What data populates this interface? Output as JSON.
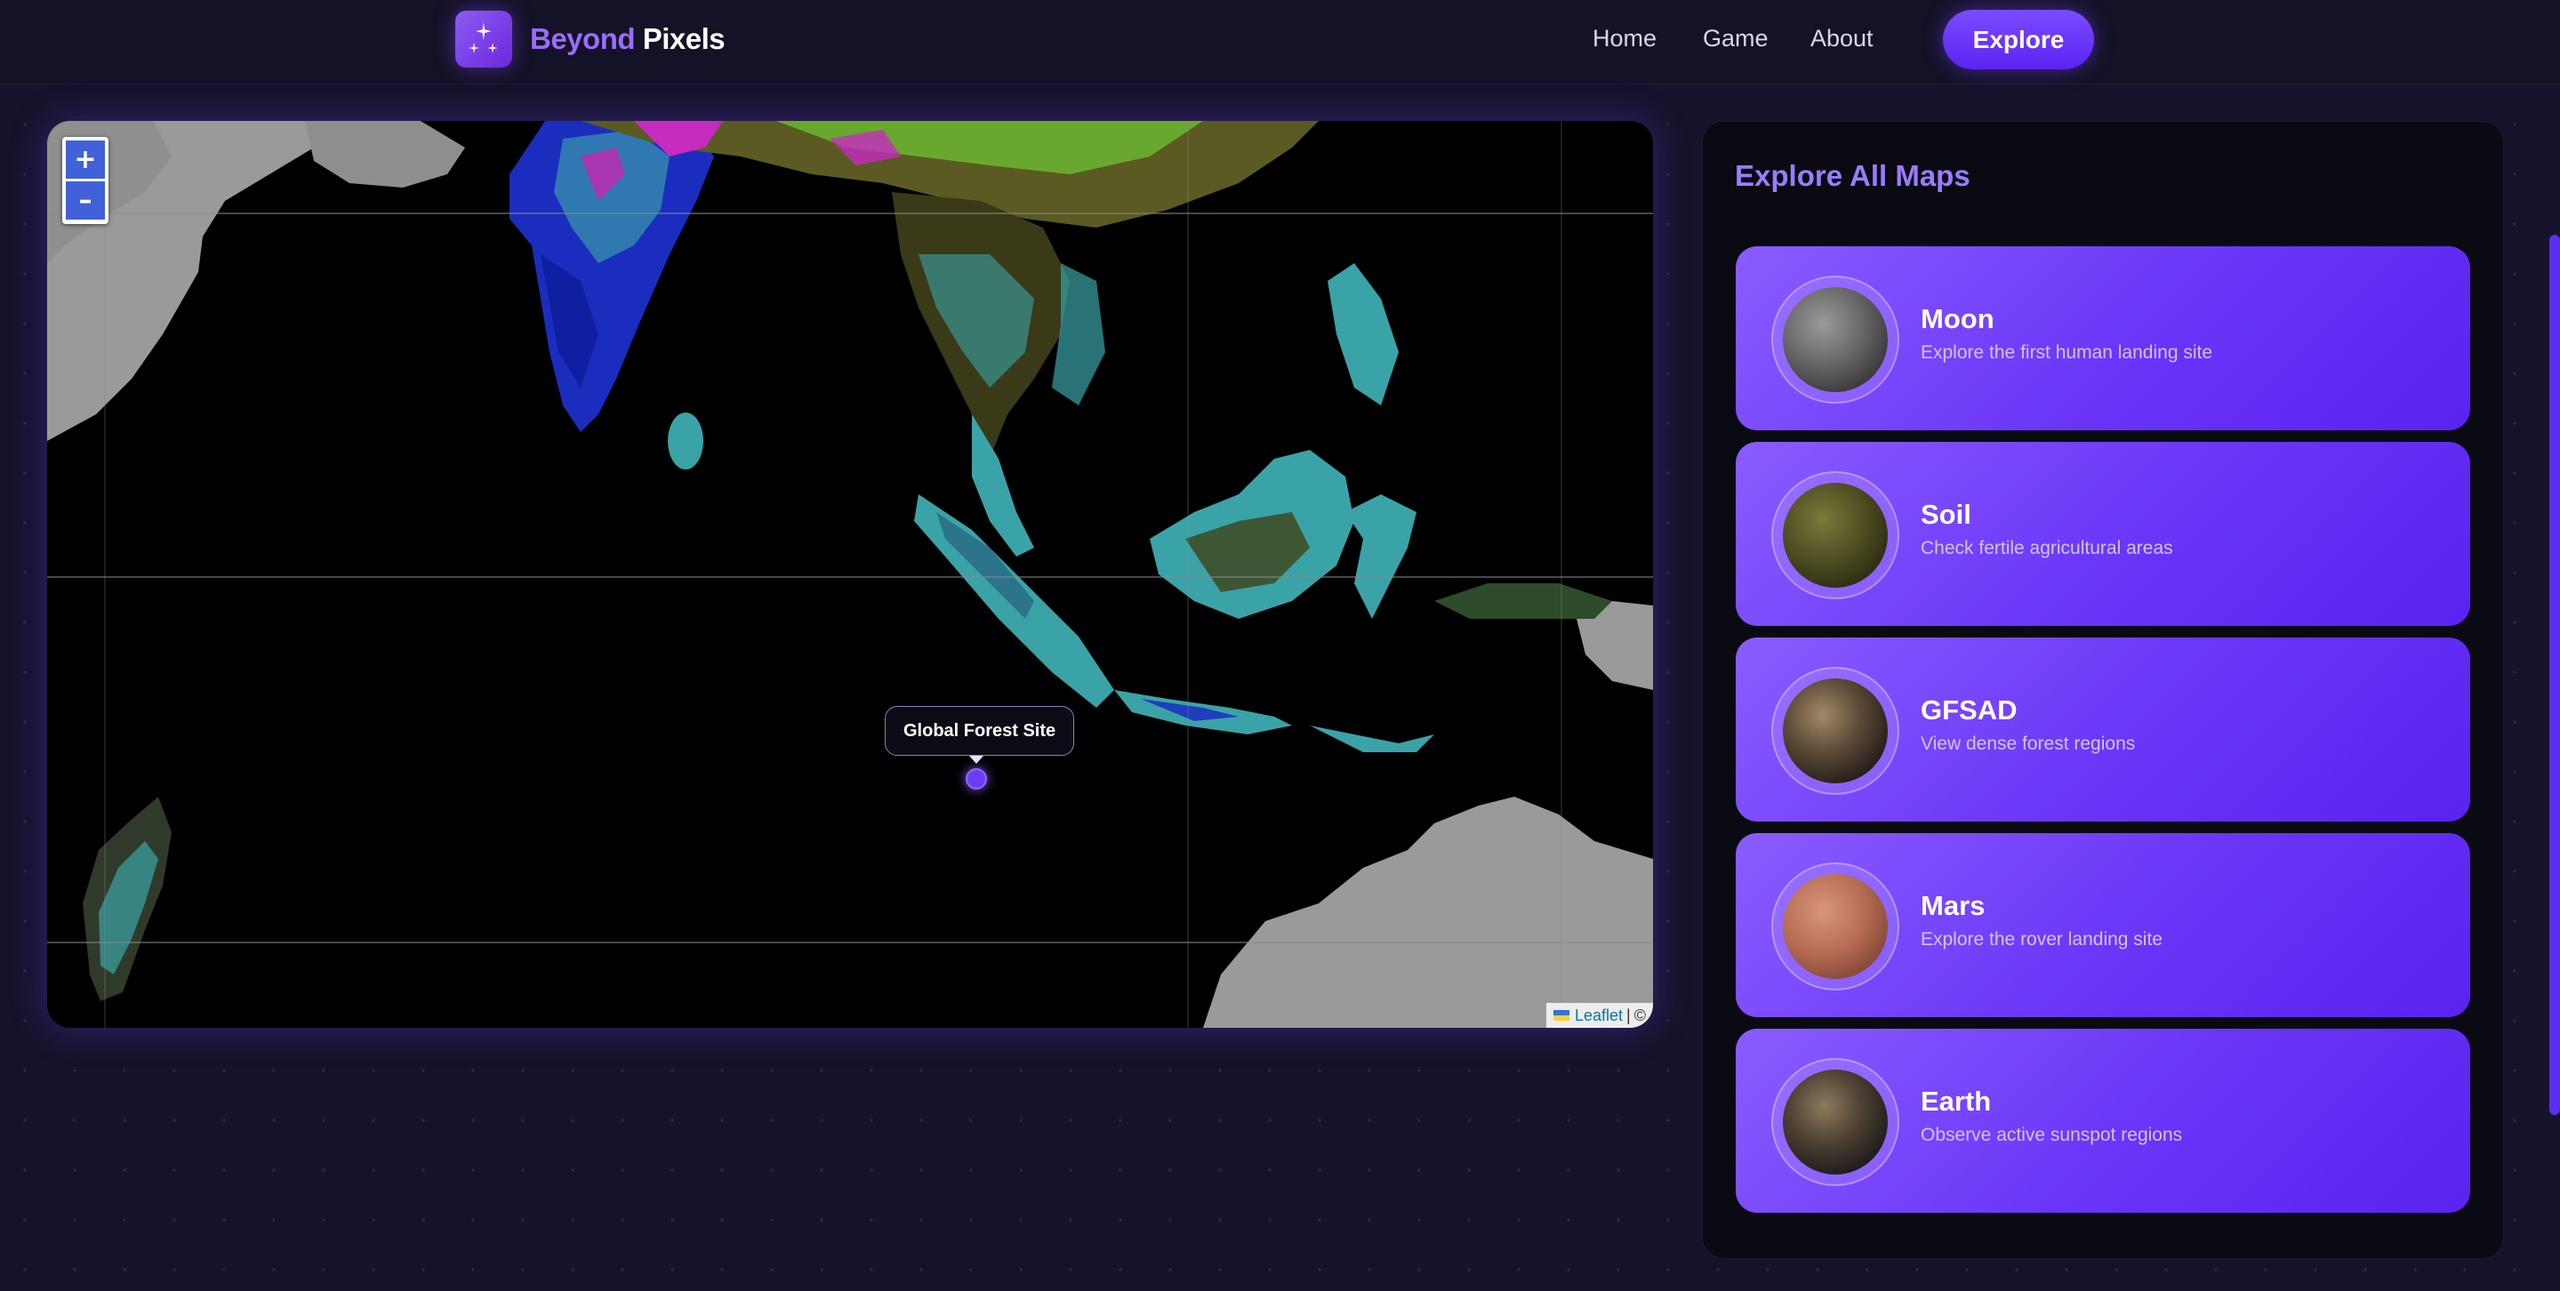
{
  "header": {
    "brand_first": "Beyond",
    "brand_second": "Pixels",
    "nav": {
      "home": "Home",
      "game": "Game",
      "about": "About"
    },
    "cta": "Explore"
  },
  "map": {
    "zoom_in": "+",
    "zoom_out": "–",
    "marker_label": "Global Forest Site",
    "attribution_link": "Leaflet",
    "attribution_sep": "|",
    "attribution_copy": "©"
  },
  "panel": {
    "title": "Explore All Maps",
    "cards": [
      {
        "title": "Moon",
        "desc": "Explore the first human landing site",
        "icon": "moon-orb-icon"
      },
      {
        "title": "Soil",
        "desc": "Check fertile agricultural areas",
        "icon": "soil-orb-icon"
      },
      {
        "title": "GFSAD",
        "desc": "View dense forest regions",
        "icon": "earth-orb-icon"
      },
      {
        "title": "Mars",
        "desc": "Explore the rover landing site",
        "icon": "mars-orb-icon"
      },
      {
        "title": "Earth",
        "desc": "Observe active sunspot regions",
        "icon": "earth-orb-icon"
      }
    ]
  },
  "colors": {
    "accent": "#6a35f7",
    "brand_purple": "#9b6cff",
    "background": "#15132b"
  }
}
